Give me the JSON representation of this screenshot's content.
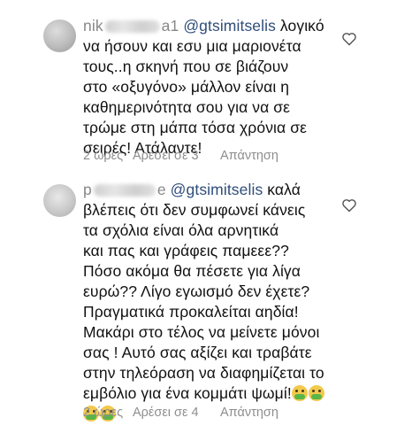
{
  "comments": [
    {
      "username_visible": "nik",
      "username_tail": "a1",
      "mention": "@gtsimitselis",
      "text_after_mention": "λογικό",
      "lines": [
        "να ήσουν και εσυ μια μαριονέτα",
        "τους..η σκηνή που σε βιάζουν",
        "στο «οξυγόνο» μάλλον είναι η",
        "καθημερινότητα σου για να σε",
        "τρώμε στη μάπα τόσα χρόνια σε",
        "σειρές! Ατάλαντε!"
      ],
      "time": "2 ώρες",
      "likes": "Αρέσει σε 3",
      "reply": "Απάντηση"
    },
    {
      "username_visible": "p",
      "username_tail": "e",
      "mention": "@gtsimitselis",
      "text_after_mention": "καλά",
      "lines": [
        "βλέπεις ότι δεν συμφωνεί κάνεις",
        "τα σχόλια είναι όλα αρνητικά",
        "και πας και γράφεις παμεεε??",
        "Πόσο ακόμα θα πέσετε για λίγα",
        "ευρώ?? Λίγο εγωισμό δεν έχετε?",
        "Πραγματικά προκαλείται αηδία!",
        "Μακάρι στο τέλος να μείνετε μόνοι",
        "σας ! Αυτό σας αξίζει και τραβάτε",
        "στην τηλεόραση να διαφημίζεται το",
        "εμβόλιο για ένα κομμάτι ψωμί!"
      ],
      "time": "2 ώρες",
      "likes": "Αρέσει σε 4",
      "reply": "Απάντηση"
    }
  ],
  "icons": {
    "like": "heart-outline-icon",
    "emoji": "nauseated-face-emoji"
  },
  "colors": {
    "mention": "#2f4d7a",
    "meta": "#8e8e8e"
  }
}
